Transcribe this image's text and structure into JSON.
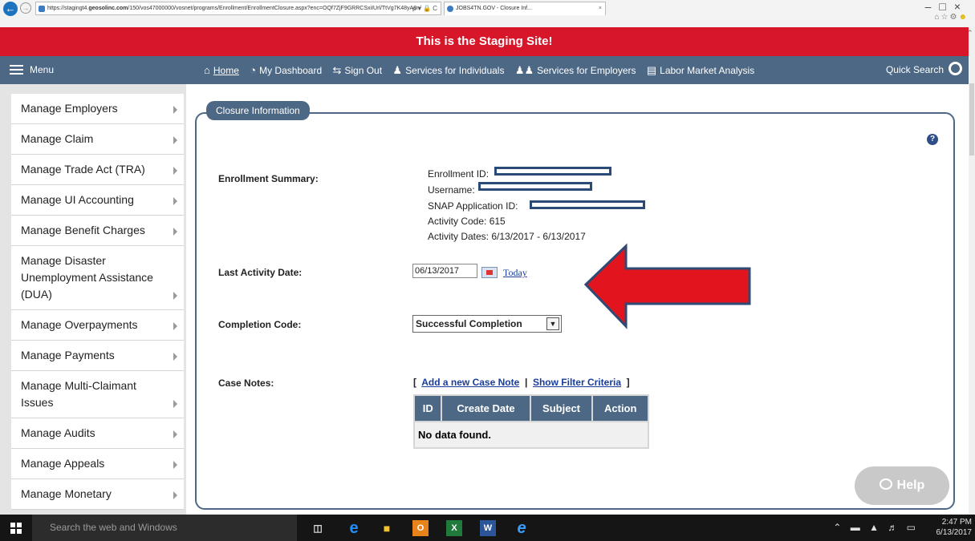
{
  "browser": {
    "url_prefix": "https://stagingt4.",
    "url_domain": "geosolinc.com",
    "url_rest": "/150/vos47000000/vosnet/programs/Enrollment/EnrollmentClosure.aspx?enc=OQf7ZjF9GRRCSxiIUrl/TtVg7K48yA8n/",
    "tab_title": "JOBS4TN.GOV - Closure Inf...",
    "addr_controls": "ρ ▾ 🔒 C"
  },
  "banner": {
    "text": "This is the Staging Site!"
  },
  "navbar": {
    "menu_label": "Menu",
    "links": [
      {
        "label": "Home",
        "icon": "home-icon"
      },
      {
        "label": "My Dashboard",
        "icon": "dashboard-icon"
      },
      {
        "label": "Sign Out",
        "icon": "sign-out-icon"
      },
      {
        "label": "Services for Individuals",
        "icon": "individual-icon"
      },
      {
        "label": "Services for Employers",
        "icon": "employers-icon"
      },
      {
        "label": "Labor Market Analysis",
        "icon": "chart-icon"
      }
    ],
    "quick_search": "Quick Search"
  },
  "sidebar": {
    "items": [
      {
        "label": "Manage Employers"
      },
      {
        "label": "Manage Claim"
      },
      {
        "label": "Manage Trade Act (TRA)"
      },
      {
        "label": "Manage UI Accounting"
      },
      {
        "label": "Manage Benefit Charges"
      },
      {
        "label": "Manage Disaster Unemployment Assistance (DUA)"
      },
      {
        "label": "Manage Overpayments"
      },
      {
        "label": "Manage Payments"
      },
      {
        "label": "Manage Multi-Claimant Issues"
      },
      {
        "label": "Manage Audits"
      },
      {
        "label": "Manage Appeals"
      },
      {
        "label": "Manage Monetary"
      }
    ]
  },
  "form": {
    "legend": "Closure Information",
    "enrollment_summary_label": "Enrollment Summary:",
    "summary": {
      "enrollment_id": "Enrollment ID:",
      "username": "Username:",
      "snap_id": "SNAP Application ID:",
      "activity_code": "Activity Code: 615",
      "activity_dates": "Activity Dates: 6/13/2017 - 6/13/2017"
    },
    "last_activity_label": "Last Activity Date:",
    "last_activity_value": "06/13/2017",
    "today_link": "Today",
    "completion_label": "Completion Code:",
    "completion_value": "Successful Completion",
    "case_notes_label": "Case Notes:",
    "case_links": {
      "open_bracket": "[",
      "add_note": "Add a new Case Note",
      "sep": "|",
      "show_filter": "Show Filter Criteria",
      "close_bracket": "]"
    },
    "table": {
      "headers": [
        "ID",
        "Create Date",
        "Subject",
        "Action"
      ],
      "empty_text": "No data found."
    },
    "help_pill": "Help"
  },
  "taskbar": {
    "search_placeholder": "Search the web and Windows",
    "clock_time": "2:47 PM",
    "clock_date": "6/13/2017"
  }
}
